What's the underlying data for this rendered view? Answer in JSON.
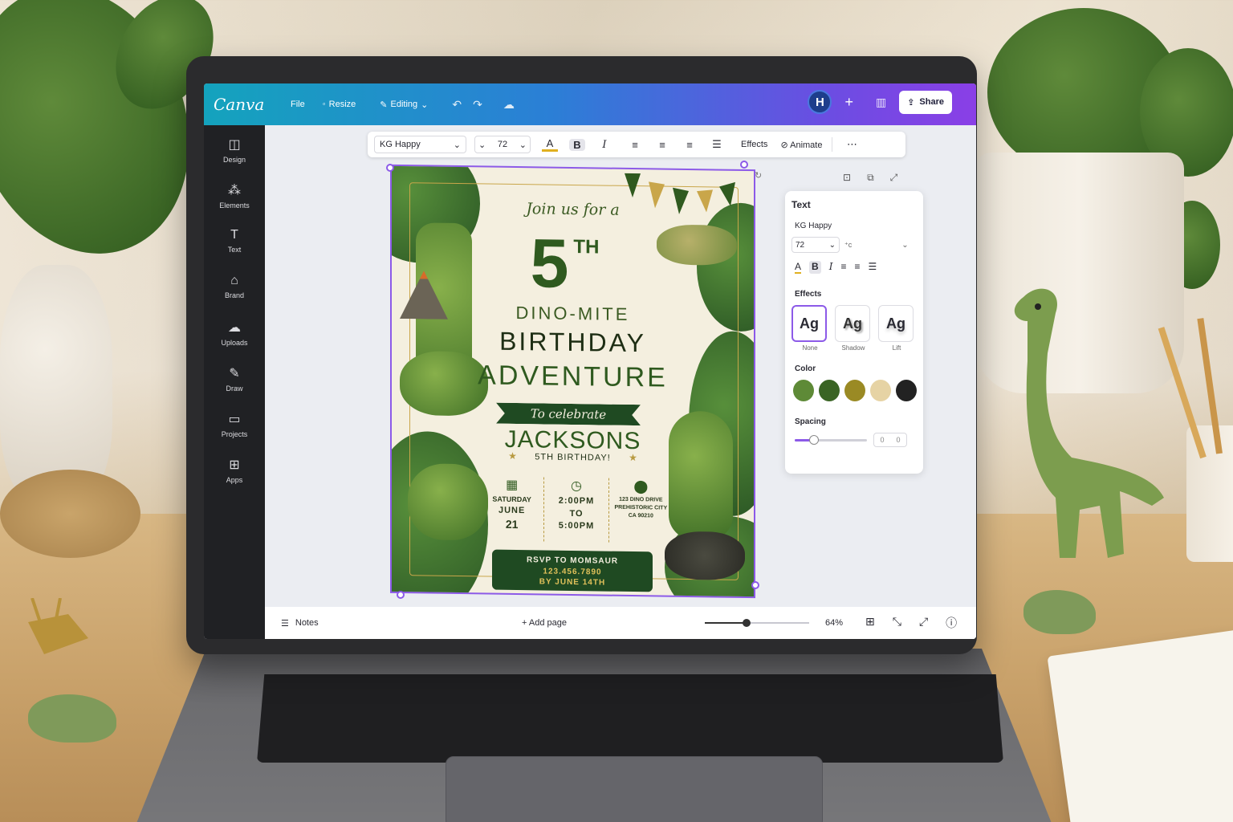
{
  "app": {
    "logo": "Canva",
    "menu": {
      "file": "File",
      "resize": "Resize",
      "editing": "Editing"
    },
    "avatar_initial": "H",
    "share_label": "Share"
  },
  "sidebar": {
    "items": [
      {
        "label": "Design",
        "icon": "design-icon"
      },
      {
        "label": "Elements",
        "icon": "elements-icon"
      },
      {
        "label": "Text",
        "icon": "text-icon"
      },
      {
        "label": "Brand",
        "icon": "brand-icon"
      },
      {
        "label": "Uploads",
        "icon": "uploads-icon"
      },
      {
        "label": "Draw",
        "icon": "draw-icon"
      },
      {
        "label": "Projects",
        "icon": "folder-icon"
      },
      {
        "label": "Apps",
        "icon": "apps-icon"
      }
    ]
  },
  "toolbar": {
    "font": "KG Happy",
    "size": "72",
    "effects_label": "Effects",
    "animate_label": "Animate"
  },
  "design": {
    "join": "Join us for a",
    "number": "5",
    "ordinal": "TH",
    "dinomite": "DINO-MITE",
    "birthday": "BIRTHDAY",
    "adventure": "ADVENTURE",
    "celebrate": "To celebrate",
    "name": "JACKSONS",
    "subtitle": "5TH BIRTHDAY!",
    "date": {
      "day": "SATURDAY",
      "month": "JUNE",
      "num": "21"
    },
    "time": {
      "start": "2:00PM",
      "to": "TO",
      "end": "5:00PM"
    },
    "address": {
      "line1": "123 DINO DRIVE",
      "line2": "PREHISTORIC CITY",
      "line3": "CA 90210"
    },
    "rsvp": {
      "line1": "RSVP TO MOMSAUR",
      "phone": "123.456.7890",
      "by": "BY JUNE 14TH"
    }
  },
  "panel": {
    "title": "Text",
    "font": "KG Happy",
    "size": "72",
    "effects_label": "Effects",
    "effects": [
      {
        "sample": "Ag",
        "label": "None"
      },
      {
        "sample": "Ag",
        "label": "Shadow"
      },
      {
        "sample": "Ag",
        "label": "Lift"
      }
    ],
    "color_label": "Color",
    "colors": [
      "#5e8a37",
      "#3a6424",
      "#9a8a24",
      "#e6d3a4",
      "#222222"
    ],
    "spacing_label": "Spacing",
    "spacing_value": "0",
    "spacing_unit": "0"
  },
  "bottombar": {
    "notes_label": "Notes",
    "add_page_label": "+ Add page",
    "zoom": "64%",
    "zoom_fraction": 0.4
  }
}
